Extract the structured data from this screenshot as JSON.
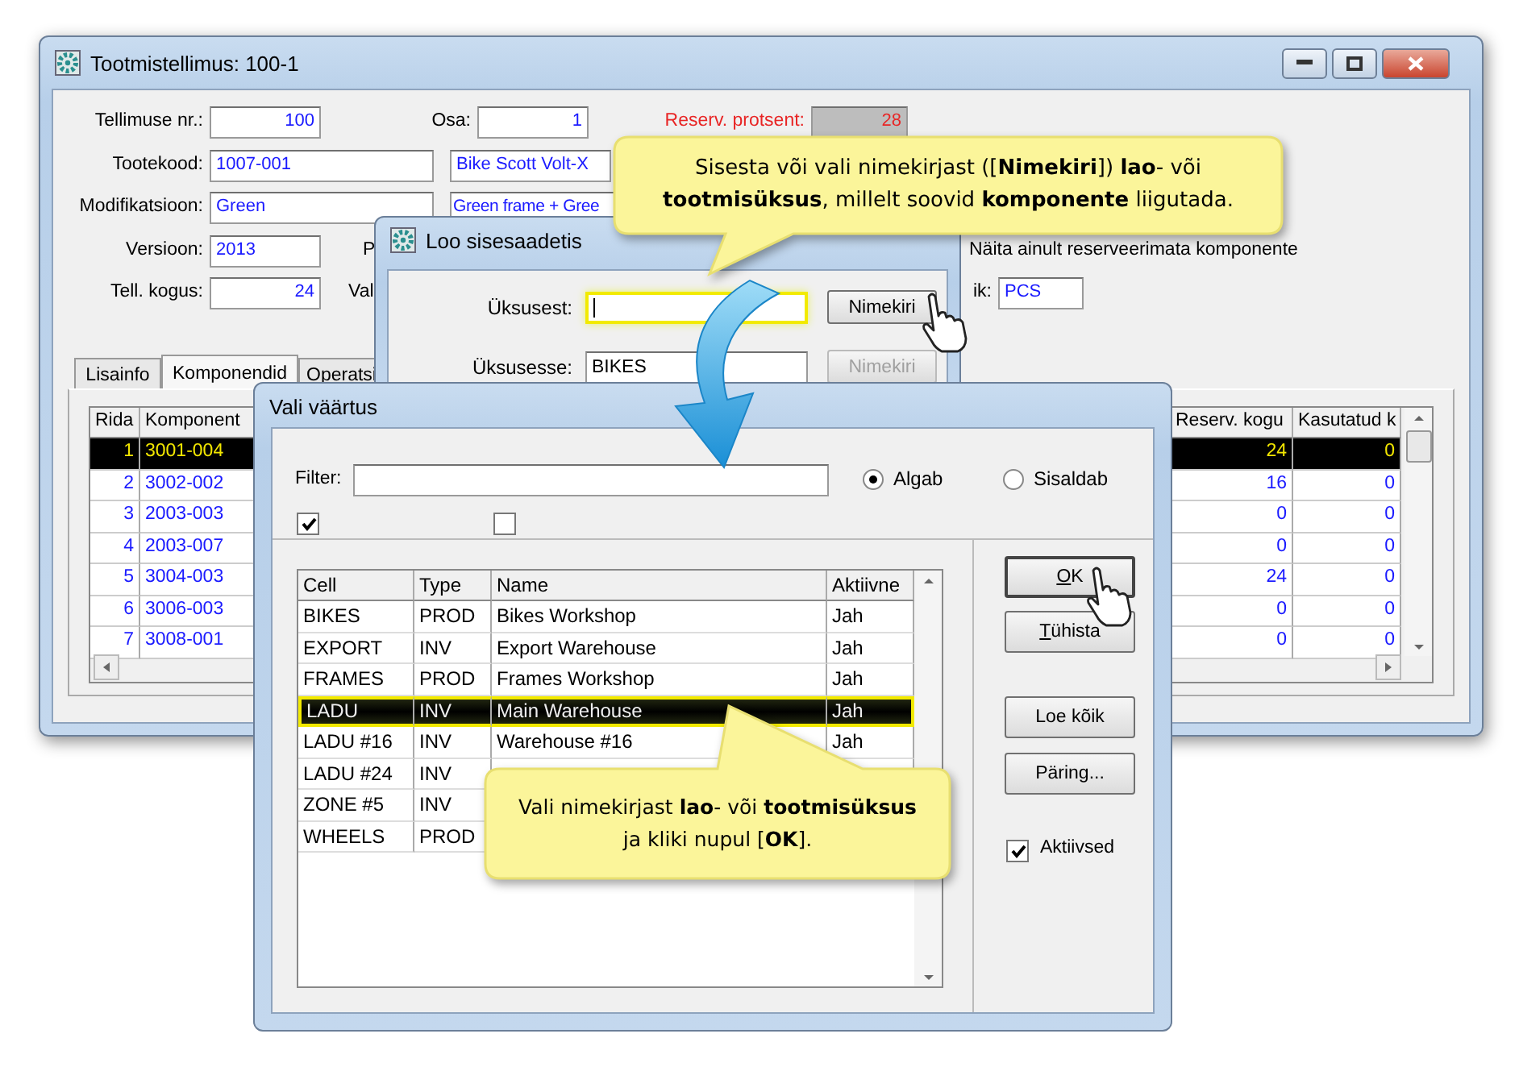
{
  "main_window": {
    "title": "Tootmistellimus: 100-1",
    "form": [
      {
        "label": "Tellimuse nr.:",
        "value": "100"
      },
      {
        "label": "Osa:",
        "value": "1"
      },
      {
        "label": "Reserv. protsent:",
        "value": "28",
        "readonly": true
      },
      {
        "label": "Tootekood:",
        "value": "1007-001"
      },
      {
        "value": "Bike Scott Volt-X"
      },
      {
        "label": "Modifikatsioon:",
        "value": "Green"
      },
      {
        "value": "Green frame + Gree"
      },
      {
        "label": "Versioon:",
        "value": "2013"
      },
      {
        "label": "P"
      },
      {
        "label": "Tell. kogus:",
        "value": "24"
      },
      {
        "label": "Val"
      },
      {
        "label": "ik:",
        "value": "PCS"
      }
    ],
    "show_unreserved_label": "Näita ainult reserveerimata komponente",
    "tabs": [
      {
        "label": "Lisainfo",
        "selected": false
      },
      {
        "label": "Komponendid",
        "selected": true
      },
      {
        "label": "Operatsi",
        "selected": false
      }
    ],
    "grid": {
      "columns": [
        "Rida",
        "Komponent",
        "Reserv. kogu",
        "Kasutatud k"
      ],
      "rows": [
        {
          "cells": [
            "1",
            "3001-004",
            "24",
            "0"
          ],
          "selected": true
        },
        {
          "cells": [
            "2",
            "3002-002",
            "16",
            "0"
          ],
          "selected": false
        },
        {
          "cells": [
            "3",
            "2003-003",
            "0",
            "0"
          ],
          "selected": false
        },
        {
          "cells": [
            "4",
            "2003-007",
            "0",
            "0"
          ],
          "selected": false
        },
        {
          "cells": [
            "5",
            "3004-003",
            "24",
            "0"
          ],
          "selected": false
        },
        {
          "cells": [
            "6",
            "3006-003",
            "0",
            "0"
          ],
          "selected": false
        },
        {
          "cells": [
            "7",
            "3008-001",
            "0",
            "0"
          ],
          "selected": false
        }
      ]
    }
  },
  "transfer_dialog": {
    "title": "Loo sisesaadetis",
    "fields": [
      {
        "label": "Üksusest:",
        "highlighted": true,
        "focused": true,
        "button": "Nimekiri",
        "button_disabled": false
      },
      {
        "label": "Üksusesse:",
        "value": "BIKES",
        "highlighted": false,
        "focused": false,
        "button": "Nimekiri",
        "button_disabled": true
      }
    ]
  },
  "select_dialog": {
    "title": "Vali väärtus",
    "filter_label": "Filter:",
    "match_modes": [
      {
        "label": "Algab",
        "selected": true
      },
      {
        "label": "Sisaldab",
        "selected": false
      }
    ],
    "filter_checkboxes": [
      {
        "checked": true
      },
      {
        "checked": false
      }
    ],
    "list": {
      "columns": [
        "Cell",
        "Type",
        "Name",
        "Aktiivne"
      ],
      "rows": [
        {
          "cells": [
            "BIKES",
            "PROD",
            "Bikes Workshop",
            "Jah"
          ],
          "selected": false
        },
        {
          "cells": [
            "EXPORT",
            "INV",
            "Export Warehouse",
            "Jah"
          ],
          "selected": false
        },
        {
          "cells": [
            "FRAMES",
            "PROD",
            "Frames Workshop",
            "Jah"
          ],
          "selected": false
        },
        {
          "cells": [
            "LADU",
            "INV",
            "Main Warehouse",
            "Jah"
          ],
          "selected": true
        },
        {
          "cells": [
            "LADU #16",
            "INV",
            "Warehouse #16",
            "Jah"
          ],
          "selected": false
        },
        {
          "cells": [
            "LADU #24",
            "INV"
          ],
          "selected": false
        },
        {
          "cells": [
            "ZONE #5",
            "INV"
          ],
          "selected": false
        },
        {
          "cells": [
            "WHEELS",
            "PROD"
          ],
          "selected": false
        }
      ]
    },
    "buttons": [
      {
        "label": "OK",
        "mnemonic": true
      },
      {
        "label": "Tühista",
        "mnemonic": true
      },
      {
        "label": "Loe kõik",
        "mnemonic": false
      },
      {
        "label": "Päring...",
        "mnemonic": false
      }
    ],
    "active_checkbox": {
      "label": "Aktiivsed",
      "checked": true
    }
  },
  "callouts": [
    {
      "lines": [
        "Sisesta või vali nimekirjast ([**Nimekiri**]) **lao**- või",
        "**tootmisüksus**, millelt soovid **komponente** liigutada."
      ]
    },
    {
      "lines": [
        "Vali nimekirjast **lao**- või **tootmisüksus**",
        "ja kliki nupul [**OK**]."
      ]
    }
  ]
}
